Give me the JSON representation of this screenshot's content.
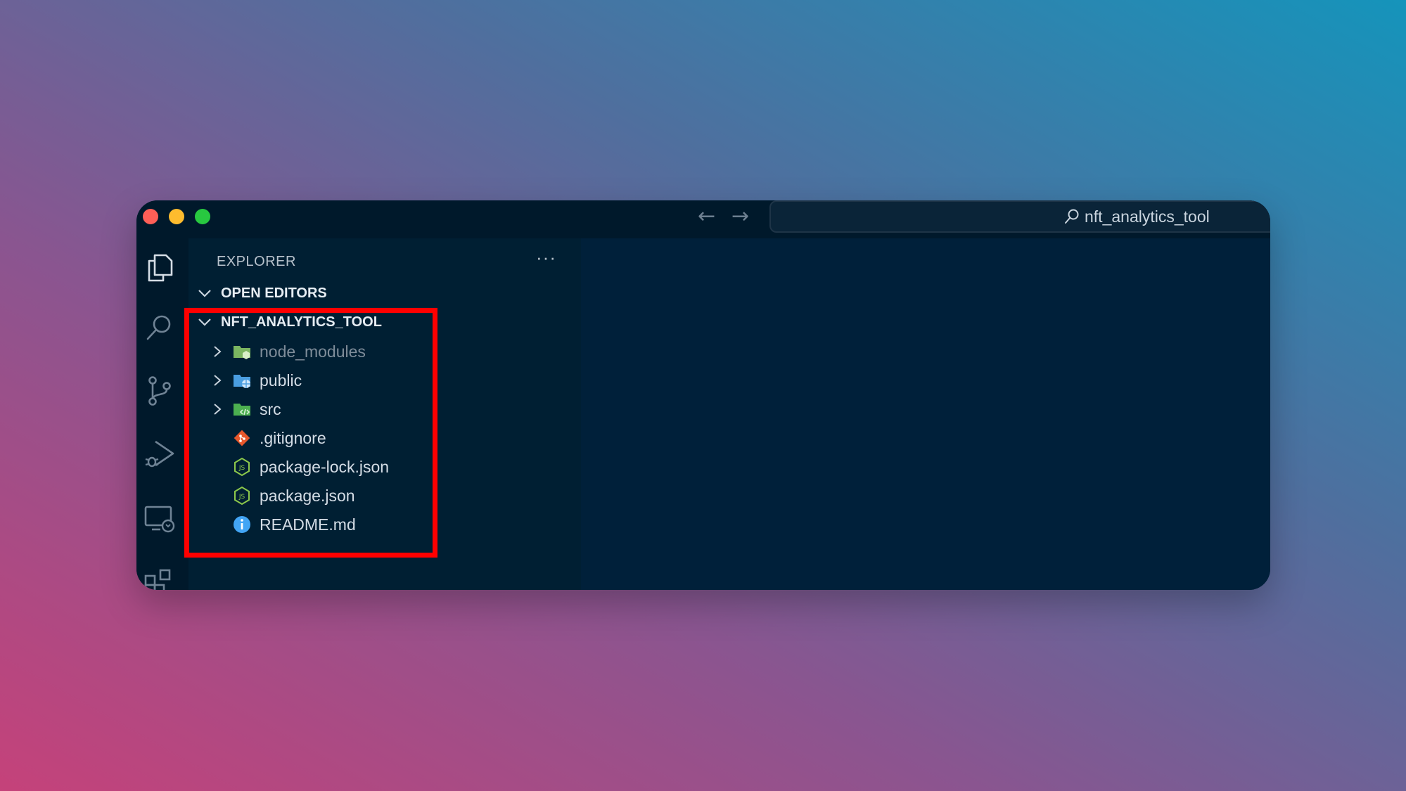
{
  "window": {
    "search_label": "nft_analytics_tool",
    "accent_colors": {
      "traffic_red": "#fe5f57",
      "traffic_yellow": "#febc2e",
      "traffic_green": "#28c840",
      "highlight": "#ff0000"
    }
  },
  "activity_bar": {
    "icons": [
      "explorer-icon",
      "search-icon",
      "source-control-icon",
      "run-debug-icon",
      "remote-explorer-icon",
      "extensions-icon"
    ]
  },
  "sidebar": {
    "title": "EXPLORER",
    "more_actions": "···",
    "open_editors_label": "OPEN EDITORS",
    "project_label": "NFT_ANALYTICS_TOOL",
    "tree": [
      {
        "label": "node_modules",
        "kind": "folder",
        "icon": "node-folder-icon"
      },
      {
        "label": "public",
        "kind": "folder",
        "icon": "public-folder-icon"
      },
      {
        "label": "src",
        "kind": "folder",
        "icon": "src-folder-icon"
      },
      {
        "label": ".gitignore",
        "kind": "file",
        "icon": "git-icon"
      },
      {
        "label": "package-lock.json",
        "kind": "file",
        "icon": "nodejs-icon"
      },
      {
        "label": "package.json",
        "kind": "file",
        "icon": "nodejs-icon"
      },
      {
        "label": "README.md",
        "kind": "file",
        "icon": "info-icon"
      }
    ]
  }
}
